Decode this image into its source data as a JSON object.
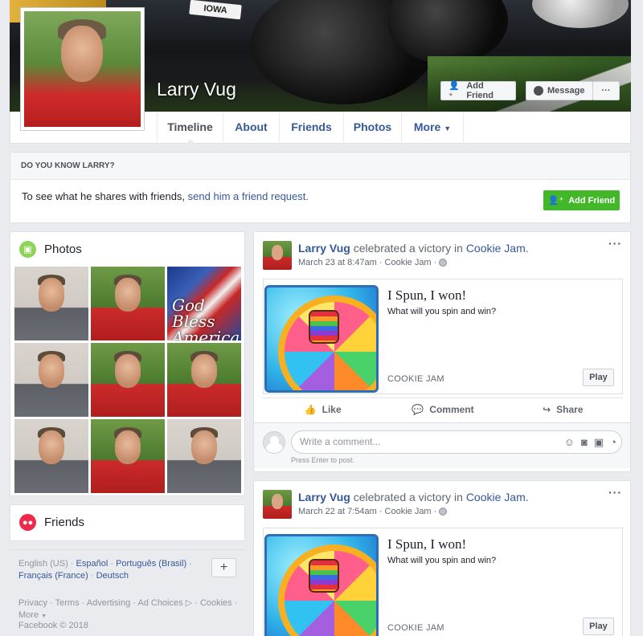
{
  "profile": {
    "name": "Larry Vug",
    "cover_plate_text": "IOWA",
    "add_friend_label": "Add Friend",
    "message_label": "Message",
    "more_dots": "···"
  },
  "nav": {
    "tabs": [
      {
        "label": "Timeline"
      },
      {
        "label": "About"
      },
      {
        "label": "Friends"
      },
      {
        "label": "Photos"
      },
      {
        "label": "More"
      }
    ]
  },
  "know_box": {
    "heading": "DO YOU KNOW LARRY?",
    "text_prefix": "To see what he shares with friends, ",
    "link_text": "send him a friend request.",
    "button_label": "Add Friend"
  },
  "photos_card": {
    "title": "Photos",
    "flag_text": "God Bless America"
  },
  "friends_card": {
    "title": "Friends"
  },
  "footer": {
    "languages": {
      "current": "English (US)",
      "others": [
        "Español",
        "Português (Brasil)",
        "Français (France)",
        "Deutsch"
      ]
    },
    "links": [
      "Privacy",
      "Terms",
      "Advertising",
      "Ad Choices",
      "Cookies",
      "More"
    ],
    "copyright": "Facebook © 2018"
  },
  "posts": [
    {
      "author": "Larry Vug",
      "action": "celebrated a victory in",
      "game": "Cookie Jam.",
      "date": "March 23 at 8:47am",
      "app": "Cookie Jam",
      "dots": "···",
      "attachment": {
        "title": "I Spun, I won!",
        "description": "What will you spin and win?",
        "source": "COOKIE JAM",
        "play_label": "Play"
      },
      "actions": {
        "like": "Like",
        "comment": "Comment",
        "share": "Share"
      },
      "comment_placeholder": "Write a comment...",
      "comment_hint": "Press Enter to post."
    },
    {
      "author": "Larry Vug",
      "action": "celebrated a victory in",
      "game": "Cookie Jam.",
      "date": "March 22 at 7:54am",
      "app": "Cookie Jam",
      "dots": "···",
      "attachment": {
        "title": "I Spun, I won!",
        "description": "What will you spin and win?",
        "source": "COOKIE JAM",
        "play_label": "Play"
      }
    }
  ],
  "colors": {
    "link": "#365899",
    "green_button": "#42b72a",
    "page_bg": "#e9ebee"
  }
}
